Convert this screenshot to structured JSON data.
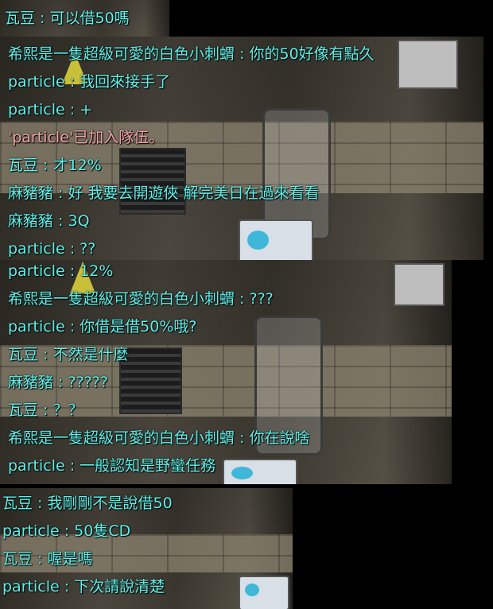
{
  "panels": [
    {
      "lines": [
        {
          "text": "瓦豆 : 可以借50嗎",
          "kind": "chat"
        }
      ]
    },
    {
      "lines": [
        {
          "text": "希熙是一隻超級可愛的白色小刺蝟 : 你的50好像有點久",
          "kind": "chat"
        },
        {
          "text": "particle : 我回來接手了",
          "kind": "chat"
        },
        {
          "text": "particle : +",
          "kind": "chat"
        },
        {
          "text": "'particle'已加入隊伍。",
          "kind": "system"
        },
        {
          "text": "瓦豆 : 才12%",
          "kind": "chat"
        },
        {
          "text": "麻豬豬 : 好 我要去開遊俠 解完美日在過來看看",
          "kind": "chat"
        },
        {
          "text": "麻豬豬 : 3Q",
          "kind": "chat"
        },
        {
          "text": "particle : ??",
          "kind": "chat"
        }
      ]
    },
    {
      "lines": [
        {
          "text": "particle : 12%",
          "kind": "chat"
        },
        {
          "text": "希熙是一隻超級可愛的白色小刺蝟 : ???",
          "kind": "chat"
        },
        {
          "text": "particle : 你借是借50%哦?",
          "kind": "chat"
        },
        {
          "text": "瓦豆 : 不然是什麼",
          "kind": "chat"
        },
        {
          "text": "麻豬豬 : ?????",
          "kind": "chat"
        },
        {
          "text": "瓦豆 : ？？",
          "kind": "chat"
        },
        {
          "text": "希熙是一隻超級可愛的白色小刺蝟 : 你在說啥",
          "kind": "chat"
        },
        {
          "text": "particle : 一般認知是野蠻任務",
          "kind": "chat"
        }
      ]
    },
    {
      "lines": [
        {
          "text": "瓦豆 : 我剛剛不是說借50",
          "kind": "chat"
        },
        {
          "text": "particle : 50隻CD",
          "kind": "chat"
        },
        {
          "text": "瓦豆 : 喔是嗎",
          "kind": "chat"
        },
        {
          "text": "particle : 下次請說清楚",
          "kind": "chat"
        }
      ]
    }
  ],
  "colors": {
    "chat_text": "#5ff0e9",
    "system_text": "#f3a3a9",
    "backdrop": "#000000"
  }
}
